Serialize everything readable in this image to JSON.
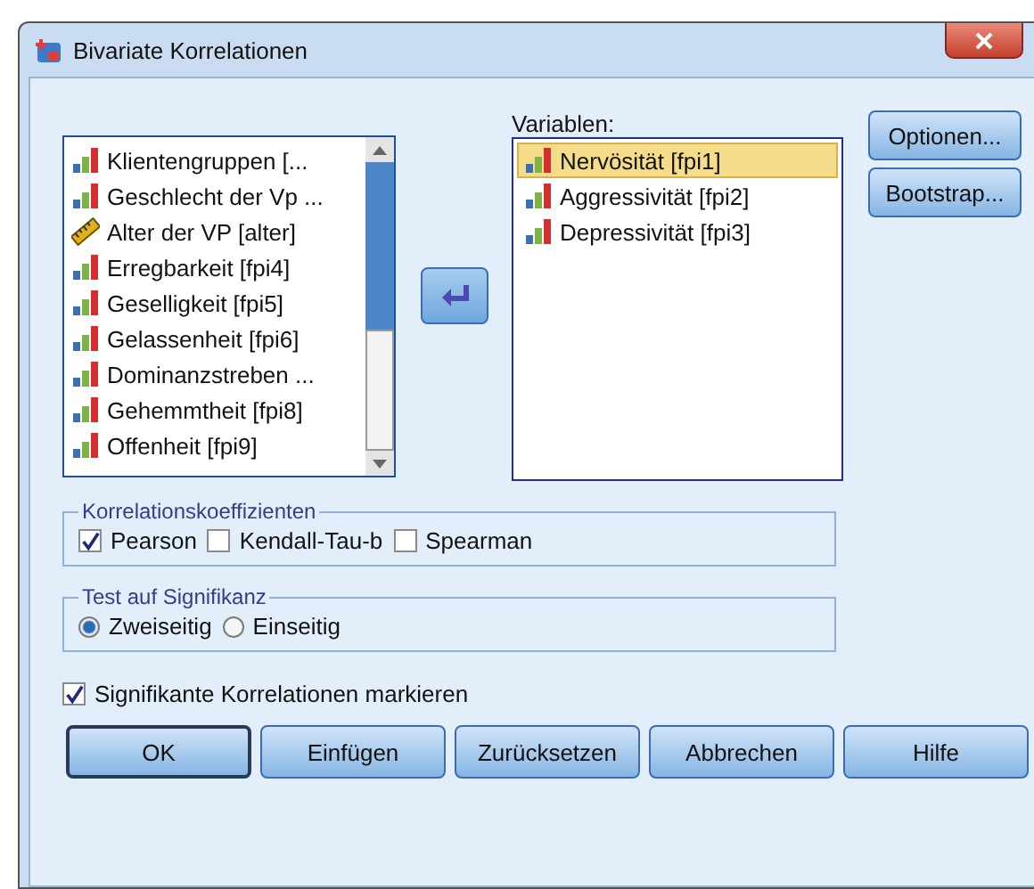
{
  "window": {
    "title": "Bivariate Korrelationen"
  },
  "source_list": {
    "items": [
      {
        "label": "Klientengruppen [...",
        "kind": "ordinal"
      },
      {
        "label": "Geschlecht der Vp ...",
        "kind": "ordinal"
      },
      {
        "label": "Alter der VP [alter]",
        "kind": "scale"
      },
      {
        "label": "Erregbarkeit [fpi4]",
        "kind": "ordinal"
      },
      {
        "label": "Geselligkeit [fpi5]",
        "kind": "ordinal"
      },
      {
        "label": "Gelassenheit [fpi6]",
        "kind": "ordinal"
      },
      {
        "label": "Dominanzstreben ...",
        "kind": "ordinal"
      },
      {
        "label": "Gehemmtheit [fpi8]",
        "kind": "ordinal"
      },
      {
        "label": "Offenheit [fpi9]",
        "kind": "ordinal"
      }
    ]
  },
  "target": {
    "label": "Variablen:",
    "items": [
      {
        "label": "Nervösität [fpi1]",
        "kind": "ordinal",
        "selected": true
      },
      {
        "label": "Aggressivität [fpi2]",
        "kind": "ordinal",
        "selected": false
      },
      {
        "label": "Depressivität [fpi3]",
        "kind": "ordinal",
        "selected": false
      }
    ]
  },
  "side_buttons": [
    "Optionen...",
    "Bootstrap..."
  ],
  "coefficients": {
    "title": "Korrelationskoeffizienten",
    "options": [
      {
        "label": "Pearson",
        "checked": true
      },
      {
        "label": "Kendall-Tau-b",
        "checked": false
      },
      {
        "label": "Spearman",
        "checked": false
      }
    ]
  },
  "significance": {
    "title": "Test auf Signifikanz",
    "options": [
      {
        "label": "Zweiseitig",
        "selected": true
      },
      {
        "label": "Einseitig",
        "selected": false
      }
    ]
  },
  "flag": {
    "label": "Signifikante Korrelationen markieren",
    "checked": true
  },
  "buttons": [
    "OK",
    "Einfügen",
    "Zurücksetzen",
    "Abbrechen",
    "Hilfe"
  ]
}
